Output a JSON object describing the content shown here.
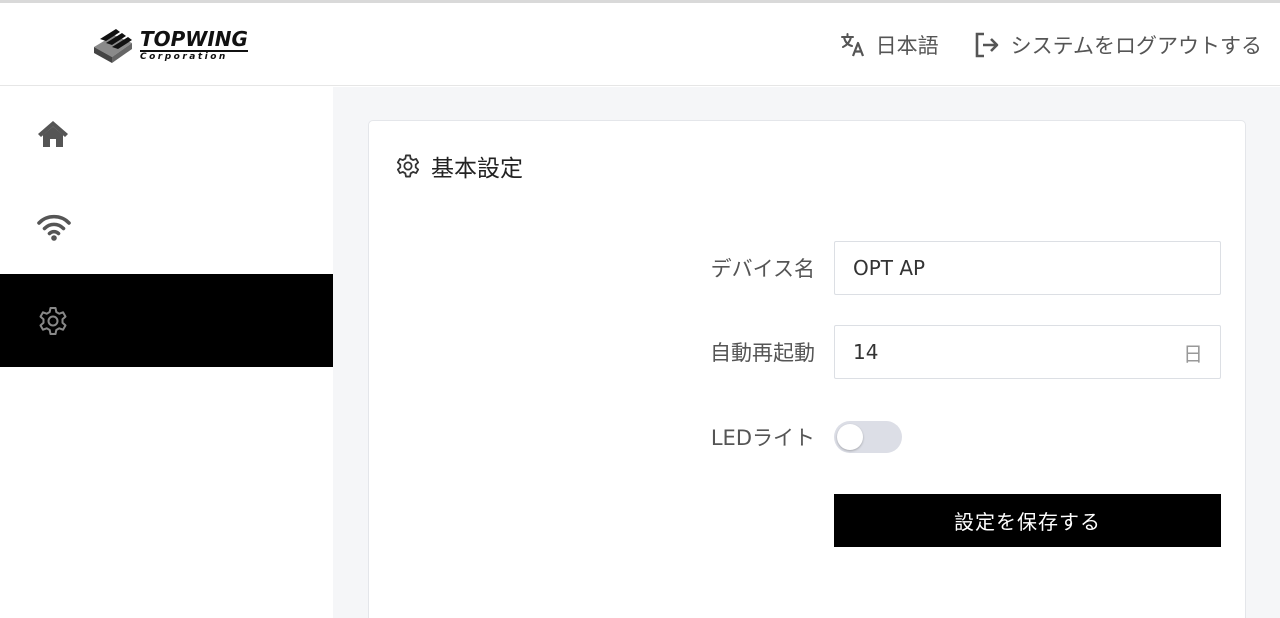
{
  "header": {
    "logo_brand": "TOPWING",
    "logo_sub": "Corporation",
    "language_label": "日本語",
    "logout_label": "システムをログアウトする"
  },
  "sidebar": {
    "items": [
      {
        "icon": "home-icon"
      },
      {
        "icon": "wifi-icon"
      },
      {
        "icon": "gear-icon",
        "active": true
      }
    ]
  },
  "card": {
    "title": "基本設定",
    "fields": {
      "device_name_label": "デバイス名",
      "device_name_value": "OPT AP",
      "auto_reboot_label": "自動再起動",
      "auto_reboot_value": "14",
      "auto_reboot_suffix": "日",
      "led_label": "LEDライト",
      "led_on": false
    },
    "save_label": "設定を保存する"
  },
  "colors": {
    "active_sidebar": "#000000",
    "primary_button": "#000000",
    "content_background": "#f5f6f8",
    "toggle_off": "#dcdee6"
  }
}
